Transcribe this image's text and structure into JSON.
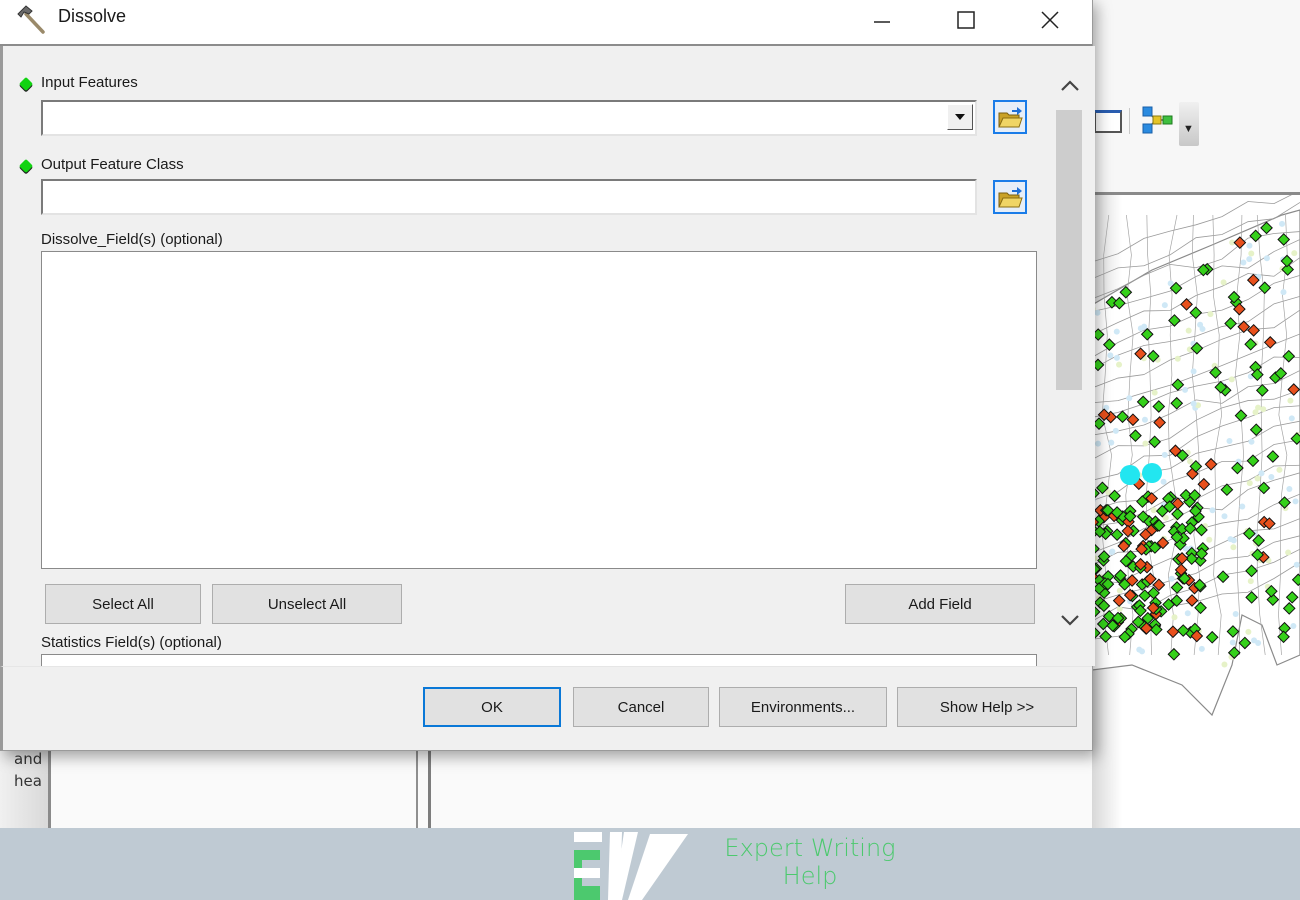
{
  "dialog": {
    "title": "Dissolve",
    "title_icon": "hammer-icon",
    "window_controls": {
      "minimize": "minimize-icon",
      "maximize": "maximize-icon",
      "close": "close-icon"
    }
  },
  "params": {
    "input_features": {
      "label": "Input Features",
      "value": "",
      "required": true
    },
    "output_feature_class": {
      "label": "Output Feature Class",
      "value": "",
      "required": true
    },
    "dissolve_fields": {
      "label": "Dissolve_Field(s) (optional)",
      "items": []
    },
    "statistics_fields": {
      "label": "Statistics Field(s) (optional)"
    }
  },
  "field_buttons": {
    "select_all": "Select All",
    "unselect_all": "Unselect All",
    "add_field": "Add Field"
  },
  "footer_buttons": {
    "ok": "OK",
    "cancel": "Cancel",
    "environments": "Environments...",
    "show_help": "Show Help >>"
  },
  "background": {
    "left_panel_lines": [
      "and",
      "hea"
    ],
    "map_colors": {
      "green": "#35d11a",
      "orange": "#e8501c",
      "cyan": "#22e6f0",
      "boundary": "#8a8a8a"
    }
  },
  "branding": {
    "logo_text_line1": "Expert Writing",
    "logo_text_line2": "Help",
    "logo_color": "#4cc96e"
  }
}
